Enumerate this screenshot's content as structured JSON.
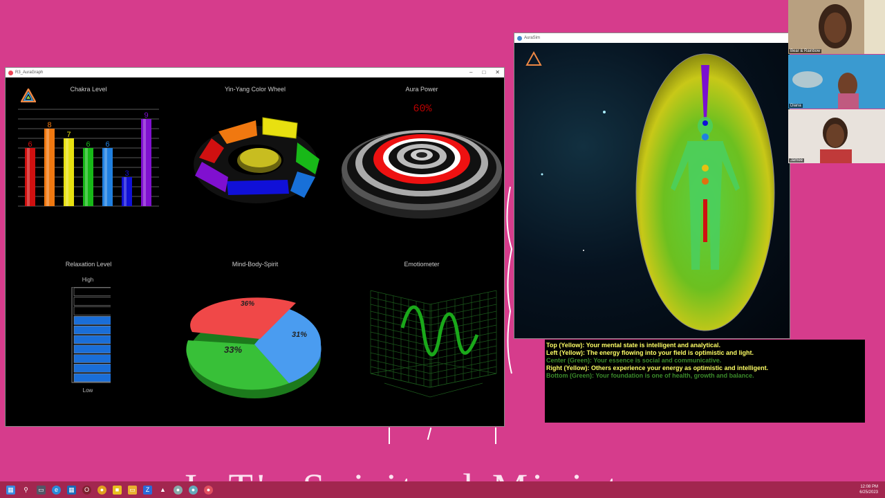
{
  "background": {
    "text": "J. T's Spiritual Ministry",
    "color": "#d63c8c"
  },
  "auragraph": {
    "title": "R3_AuraGraph",
    "chakra": {
      "title": "Chakra Level",
      "bars": [
        {
          "value": 6,
          "color": "#d01010"
        },
        {
          "value": 8,
          "color": "#f07810"
        },
        {
          "value": 7,
          "color": "#e8e010"
        },
        {
          "value": 6,
          "color": "#18b818"
        },
        {
          "value": 6,
          "color": "#2080e0"
        },
        {
          "value": 3,
          "color": "#1010d8"
        },
        {
          "value": 9,
          "color": "#8010d0"
        }
      ],
      "labels": [
        "6",
        "8",
        "7",
        "6",
        "6",
        "3",
        "9"
      ]
    },
    "yinyang": {
      "title": "Yin-Yang Color Wheel"
    },
    "aura_power": {
      "title": "Aura Power",
      "value_label": "60%",
      "value": 60
    },
    "relaxation": {
      "title": "Relaxation Level",
      "high": "High",
      "low": "Low",
      "level": 0.65
    },
    "mind_body_spirit": {
      "title": "Mind-Body-Spirit",
      "slices": [
        {
          "label": "36%",
          "value": 36,
          "color": "#f04848"
        },
        {
          "label": "31%",
          "value": 31,
          "color": "#4a9cf0"
        },
        {
          "label": "33%",
          "value": 33,
          "color": "#38c038"
        }
      ]
    },
    "emotiometer": {
      "title": "Emotiometer"
    }
  },
  "aurasim": {
    "title": "AuraSim"
  },
  "aura_text": {
    "lines": [
      {
        "text": "Top (Yellow): Your mental state is intelligent and analytical.",
        "color": "yellow"
      },
      {
        "text": "Left (Yellow): The energy flowing into your field is optimistic and light.",
        "color": "yellow"
      },
      {
        "text": "Center (Green): Your essence is social and communicative.",
        "color": "green"
      },
      {
        "text": "Right (Yellow): Others experience your energy as optimistic and intelligent.",
        "color": "yellow"
      },
      {
        "text": "Bottom (Green): Your foundation is one of health, growth and balance.",
        "color": "green"
      }
    ]
  },
  "participants": [
    {
      "name": "Bear & Rainbow"
    },
    {
      "name": "Diana"
    },
    {
      "name": "Jamee"
    }
  ],
  "taskbar": {
    "time": "12:08 PM",
    "date": "6/25/2023"
  }
}
